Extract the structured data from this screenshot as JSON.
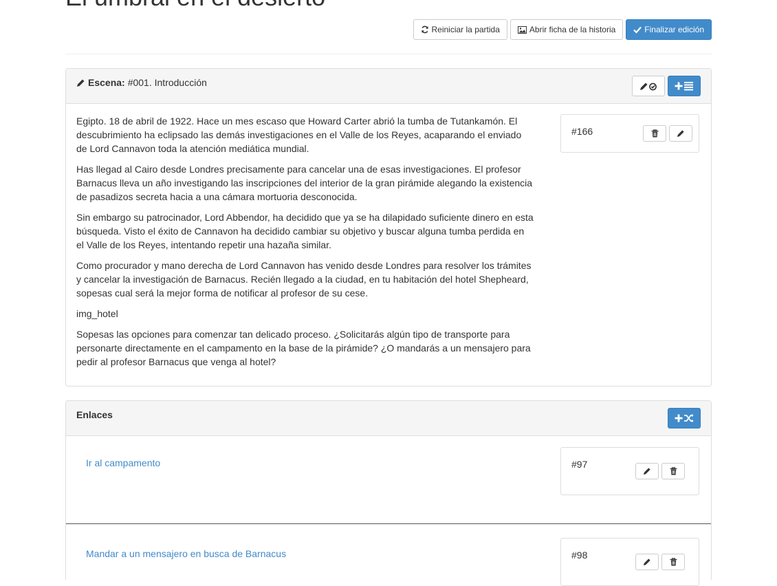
{
  "page": {
    "title": "El umbral en el desierto"
  },
  "toolbar": {
    "restart_label": "Reiniciar la partida",
    "open_story_label": "Abrir ficha de la historia",
    "finish_label": "Finalizar edición"
  },
  "scene": {
    "label": "Escena:",
    "title": "#001. Introducción",
    "paragraphs": [
      "Egipto. 18 de abril de 1922. Hace un mes escaso que Howard Carter abrió la tumba de Tutankamón. El descubrimiento ha eclipsado las demás investigaciones en el Valle de los Reyes, acaparando el enviado de Lord Cannavon toda la atención mediática mundial.",
      "Has llegad al Cairo desde Londres precisamente para cancelar una de esas investigaciones. El profesor Barnacus lleva un año investigando las inscripciones del interior de la gran pirámide alegando la existencia de pasadizos secreta hacia a una cámara mortuoria desconocida.",
      "Sin embargo su patrocinador, Lord Abbendor, ha decidido que ya se ha dilapidado suficiente dinero en esta búsqueda. Visto el éxito de Cannavon ha decidido cambiar su objetivo y buscar alguna tumba perdida en el Valle de los Reyes, intentando repetir una hazaña similar.",
      "Como procurador y mano derecha de Lord Cannavon has venido desde Londres para resolver los trámites y cancelar la investigación de Barnacus. Recién llegado a la ciudad, en tu habitación del hotel Shepheard, sopesas cual será la mejor forma de notificar al profesor de su cese.",
      "img_hotel",
      "Sopesas las opciones para comenzar tan delicado proceso. ¿Solicitarás algún tipo de transporte para personarte directamente en el campamento en la base de la pirámide? ¿O mandarás a un mensajero para pedir al profesor Barnacus que venga al hotel?"
    ],
    "paragraph_id": "#166"
  },
  "links": {
    "title": "Enlaces",
    "items": [
      {
        "text": "Ir al campamento",
        "id": "#97"
      },
      {
        "text": "Mandar a un mensajero en busca de Barnacus",
        "id": "#98"
      }
    ]
  },
  "icons": {
    "restart": "refresh-icon",
    "open_story": "image-icon",
    "finish": "check-icon",
    "edit": "pencil-icon",
    "delete": "trash-icon",
    "add_paragraph": "plus-list-icon",
    "add_link": "plus-shuffle-icon"
  },
  "colors": {
    "primary": "#428bca",
    "link": "#428bca",
    "panel_heading": "#f5f5f5"
  }
}
